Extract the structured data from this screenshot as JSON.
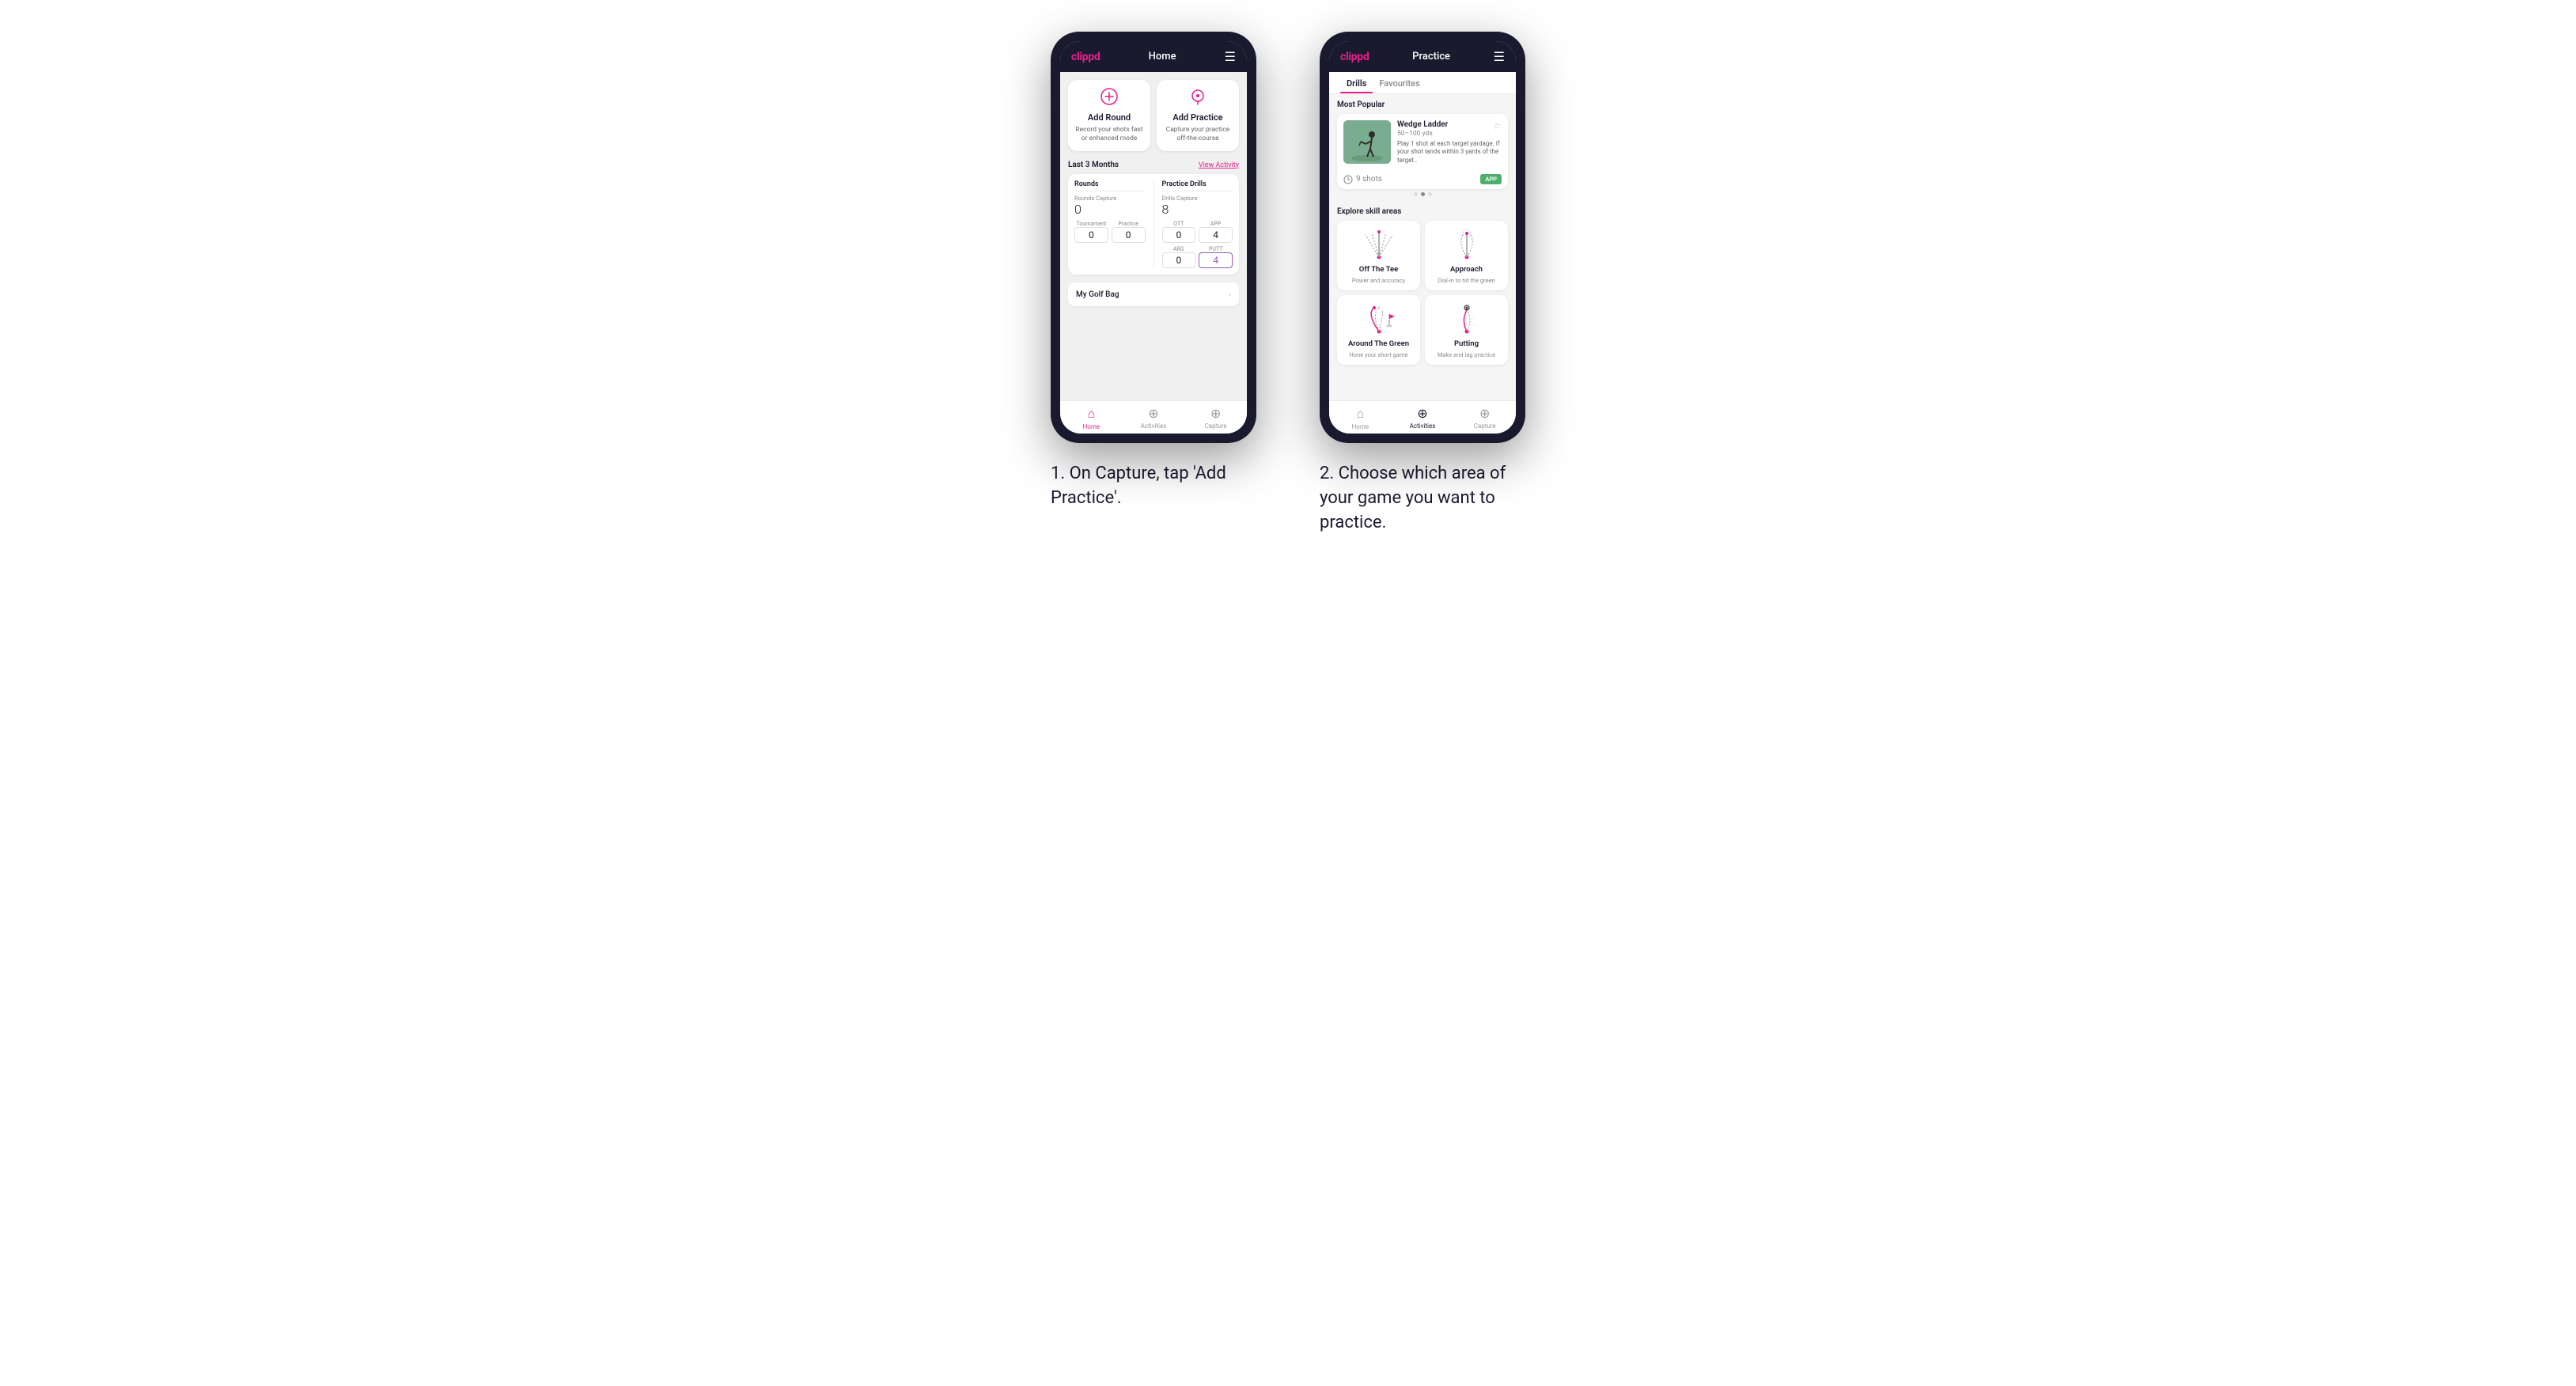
{
  "phone1": {
    "header": {
      "logo": "clippd",
      "title": "Home",
      "menu_icon": "☰"
    },
    "card_add_round": {
      "title": "Add Round",
      "subtitle": "Record your shots fast or enhanced mode",
      "icon": "⛳"
    },
    "card_add_practice": {
      "title": "Add Practice",
      "subtitle": "Capture your practice off-the-course",
      "icon": "🎯"
    },
    "stats_period": "Last 3 Months",
    "view_activity": "View Activity",
    "rounds_col": {
      "title": "Rounds",
      "rounds_capture_label": "Rounds Capture",
      "rounds_value": "0",
      "tournament_label": "Tournament",
      "tournament_value": "0",
      "practice_label": "Practice",
      "practice_value": "0"
    },
    "drills_col": {
      "title": "Practice Drills",
      "drills_capture_label": "Drills Capture",
      "drills_value": "8",
      "ott_label": "OTT",
      "ott_value": "0",
      "app_label": "APP",
      "app_value": "4",
      "arg_label": "ARG",
      "arg_value": "0",
      "putt_label": "PUTT",
      "putt_value": "4"
    },
    "golf_bag": "My Golf Bag",
    "nav": {
      "home": "Home",
      "activities": "Activities",
      "capture": "Capture"
    }
  },
  "phone2": {
    "header": {
      "logo": "clippd",
      "title": "Practice",
      "menu_icon": "☰"
    },
    "tabs": [
      "Drills",
      "Favourites"
    ],
    "active_tab": "Drills",
    "most_popular_title": "Most Popular",
    "featured_drill": {
      "title": "Wedge Ladder",
      "yards": "50–100 yds",
      "description": "Play 1 shot at each target yardage. If your shot lands within 3 yards of the target..",
      "shots": "9 shots",
      "badge": "APP"
    },
    "explore_title": "Explore skill areas",
    "skills": [
      {
        "title": "Off The Tee",
        "subtitle": "Power and accuracy",
        "diagram": "tee"
      },
      {
        "title": "Approach",
        "subtitle": "Dial-in to hit the green",
        "diagram": "approach"
      },
      {
        "title": "Around The Green",
        "subtitle": "Hone your short game",
        "diagram": "atg"
      },
      {
        "title": "Putting",
        "subtitle": "Make and lag practice",
        "diagram": "putting"
      }
    ],
    "nav": {
      "home": "Home",
      "activities": "Activities",
      "capture": "Capture"
    }
  },
  "caption1": {
    "step": "1.",
    "text": "On Capture, tap 'Add Practice'."
  },
  "caption2": {
    "step": "2.",
    "text": "Choose which area of your game you want to practice."
  }
}
